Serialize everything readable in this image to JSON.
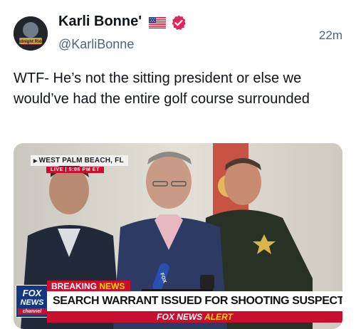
{
  "tweet": {
    "display_name": "Karli Bonne'",
    "handle": "@KarliBonne",
    "time": "22m",
    "text": "WTF- He’s not the sitting president or else we would’ve had the entire golf course surrounded",
    "avatar_text": "Midnight Rider",
    "icons": {
      "flag": "us-flag-icon",
      "verified": "verified-badge-icon"
    },
    "colors": {
      "verified": "#e0245e",
      "secondary_text": "#536471"
    }
  },
  "media": {
    "location": "WEST PALM BEACH, FL",
    "live_badge": "LIVE | 5:06 PM ET",
    "mic_label": "FOX",
    "breaking": "BREAKING",
    "breaking_news": "NEWS",
    "headline": "SEARCH WARRANT ISSUED FOR SHOOTING SUSPECT'S CAR",
    "network_line1": "FOX",
    "network_line2": "NEWS",
    "network_line3": "channel",
    "alert_brand": "FOX NEWS",
    "alert_word": "ALERT",
    "colors": {
      "red": "#c8102e",
      "navy": "#14387f",
      "yellow": "#ffd400"
    }
  }
}
